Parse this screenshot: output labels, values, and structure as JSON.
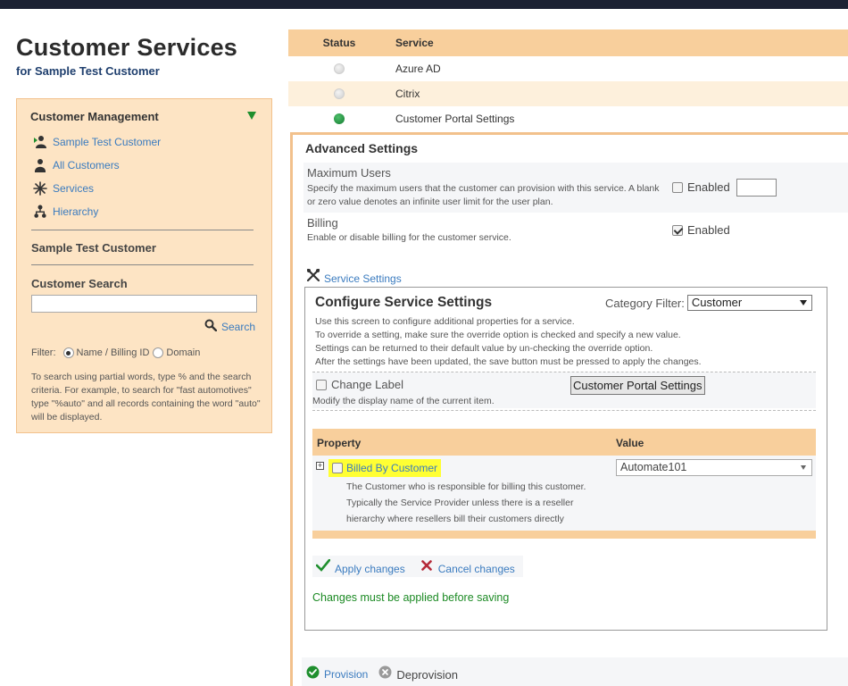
{
  "header": {
    "title": "Customer Services",
    "subtitle": "for Sample Test Customer"
  },
  "sidebar": {
    "title": "Customer Management",
    "items": [
      {
        "label": "Sample Test Customer",
        "icon": "user-play-icon"
      },
      {
        "label": "All Customers",
        "icon": "users-icon"
      },
      {
        "label": "Services",
        "icon": "snowflake-icon"
      },
      {
        "label": "Hierarchy",
        "icon": "hierarchy-icon"
      }
    ],
    "section_customer": "Sample Test Customer",
    "section_search": "Customer Search",
    "search_value": "",
    "search_label": "Search",
    "filter_label": "Filter:",
    "filter_options": [
      "Name / Billing ID",
      "Domain"
    ],
    "filter_selected": "Name / Billing ID",
    "help_text": "To search using partial words, type % and the search criteria. For example, to search for \"fast automotives\" type \"%auto\" and all records containing the word \"auto\" will be displayed."
  },
  "services_table": {
    "columns": [
      "Status",
      "Service"
    ],
    "rows": [
      {
        "status": "inactive",
        "service": "Azure AD"
      },
      {
        "status": "inactive",
        "service": "Citrix"
      },
      {
        "status": "active",
        "service": "Customer Portal Settings"
      }
    ]
  },
  "advanced": {
    "title": "Advanced Settings",
    "max_users": {
      "name": "Maximum Users",
      "description": "Specify the maximum users that the customer can provision with this service. A blank or zero value denotes an infinite user limit for the user plan.",
      "enabled_label": "Enabled",
      "enabled": false,
      "value": ""
    },
    "billing": {
      "name": "Billing",
      "description": "Enable or disable billing for the customer service.",
      "enabled_label": "Enabled",
      "enabled": true
    },
    "service_settings_link": "Service Settings"
  },
  "configure": {
    "title": "Configure Service Settings",
    "category_filter_label": "Category Filter:",
    "category_filter_value": "Customer",
    "help_lines": [
      "Use this screen to configure additional properties for a service.",
      "To override a setting, make sure the override option is checked and specify a new value.",
      "Settings can be returned to their default value by un-checking the override option.",
      "After the settings have been updated, the save button must be pressed to apply the changes."
    ],
    "change_label": "Change Label",
    "change_label_button": "Customer Portal Settings",
    "change_label_desc": "Modify the display name of the current item.",
    "property_header": "Property",
    "value_header": "Value",
    "property": {
      "name": "Billed By Customer",
      "desc_lines": [
        "The Customer who is responsible for billing this customer.",
        "Typically the Service Provider unless there is a reseller",
        "hierarchy where resellers bill their customers directly"
      ],
      "value": "Automate101",
      "expander": "+"
    },
    "apply_label": "Apply changes",
    "cancel_label": "Cancel changes",
    "note": "Changes must be applied before saving"
  },
  "footer": {
    "provision_label": "Provision",
    "deprovision_label": "Deprovision"
  },
  "colors": {
    "accent_orange": "#f8cf9c",
    "panel_peach": "#fde4c4",
    "link_blue": "#3a7bbf",
    "active_green": "#1c8a24",
    "highlight_yellow": "#ffff33"
  }
}
